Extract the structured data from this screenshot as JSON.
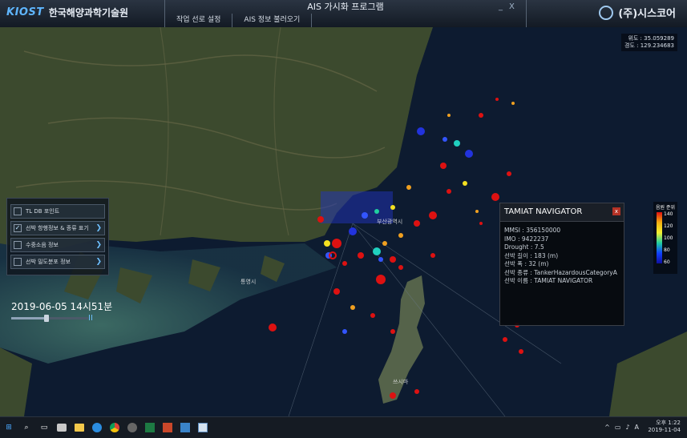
{
  "header": {
    "logo": "KIOST",
    "org_name": "한국해양과학기술원",
    "app_title": "AIS 가시화 프로그램",
    "menu": [
      "작업 선로 설정",
      "AIS 정보 불러오기"
    ],
    "company": "(주)시스코어",
    "min_symbol": "_",
    "close_symbol": "X"
  },
  "map": {
    "coordinates": [
      "위도 : 35.059289",
      "경도 : 129.234683"
    ]
  },
  "layers": [
    {
      "label": "TL DB 포인트",
      "checked": false
    },
    {
      "label": "선박 항행정보 & 종류 표기",
      "checked": true
    },
    {
      "label": "수중소음 정보",
      "checked": false
    },
    {
      "label": "선박 밀도분포 정보",
      "checked": false
    }
  ],
  "layer_check_symbol": "✓",
  "chevron_symbol": "❯",
  "datetime": "2019-06-05 14시51분",
  "playback": {
    "pause_symbol": "II",
    "progress": 0.45
  },
  "popup": {
    "title": "TAMIAT NAVIGATOR",
    "close_symbol": "x",
    "lines": [
      "MMSI : 356150000",
      "IMO : 9422237",
      "Drought : 7.5",
      "선박 길이 : 183 (m)",
      "선박 폭 : 32 (m)",
      "선박 종류 : TankerHazardousCategoryA",
      "선박 이름 : TAMIAT NAVIGATOR"
    ]
  },
  "legend": {
    "title": "음원 준위",
    "ticks": [
      "140",
      "120",
      "100",
      "80",
      "60"
    ]
  },
  "taskbar": {
    "icons": [
      "windows-start-icon",
      "search-icon",
      "task-view-icon",
      "app-icon-1",
      "file-explorer-icon",
      "edge-icon",
      "chrome-icon",
      "app-icon-2",
      "excel-icon",
      "powerpoint-icon",
      "app-icon-3",
      "app-icon-4"
    ],
    "time_line1": "오후 1:22",
    "time_line2": "2019-11-04",
    "tray_symbols": [
      "^",
      "▭",
      "♪",
      "A"
    ]
  }
}
